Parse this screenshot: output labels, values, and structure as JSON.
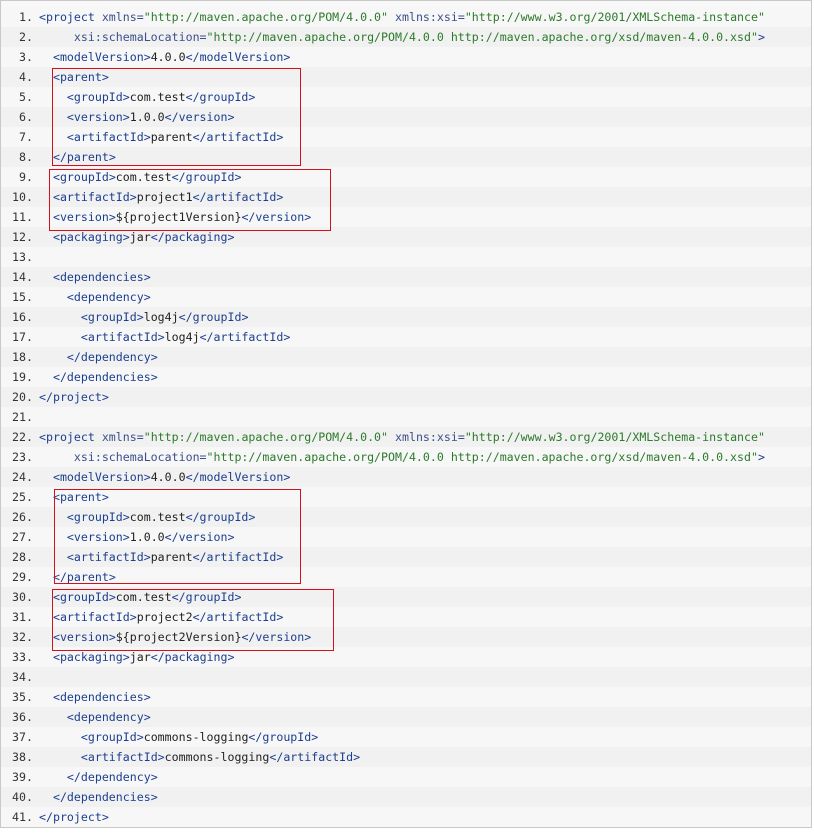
{
  "code_viewer": {
    "highlight_color": "#d3111b",
    "lines": [
      {
        "n": "1.",
        "text": "<project xmlns=\"http://maven.apache.org/POM/4.0.0\" xmlns:xsi=\"http://www.w3.org/2001/XMLSchema-instance\""
      },
      {
        "n": "2.",
        "text": "     xsi:schemaLocation=\"http://maven.apache.org/POM/4.0.0 http://maven.apache.org/xsd/maven-4.0.0.xsd\">"
      },
      {
        "n": "3.",
        "text": "  <modelVersion>4.0.0</modelVersion>"
      },
      {
        "n": "4.",
        "text": "  <parent>"
      },
      {
        "n": "5.",
        "text": "    <groupId>com.test</groupId>"
      },
      {
        "n": "6.",
        "text": "    <version>1.0.0</version>"
      },
      {
        "n": "7.",
        "text": "    <artifactId>parent</artifactId>"
      },
      {
        "n": "8.",
        "text": "  </parent>"
      },
      {
        "n": "9.",
        "text": "  <groupId>com.test</groupId>"
      },
      {
        "n": "10.",
        "text": "  <artifactId>project1</artifactId>"
      },
      {
        "n": "11.",
        "text": "  <version>${project1Version}</version>"
      },
      {
        "n": "12.",
        "text": "  <packaging>jar</packaging>"
      },
      {
        "n": "13.",
        "text": ""
      },
      {
        "n": "14.",
        "text": "  <dependencies>"
      },
      {
        "n": "15.",
        "text": "    <dependency>"
      },
      {
        "n": "16.",
        "text": "      <groupId>log4j</groupId>"
      },
      {
        "n": "17.",
        "text": "      <artifactId>log4j</artifactId>"
      },
      {
        "n": "18.",
        "text": "    </dependency>"
      },
      {
        "n": "19.",
        "text": "  </dependencies>"
      },
      {
        "n": "20.",
        "text": "</project>"
      },
      {
        "n": "21.",
        "text": ""
      },
      {
        "n": "22.",
        "text": "<project xmlns=\"http://maven.apache.org/POM/4.0.0\" xmlns:xsi=\"http://www.w3.org/2001/XMLSchema-instance\""
      },
      {
        "n": "23.",
        "text": "     xsi:schemaLocation=\"http://maven.apache.org/POM/4.0.0 http://maven.apache.org/xsd/maven-4.0.0.xsd\">"
      },
      {
        "n": "24.",
        "text": "  <modelVersion>4.0.0</modelVersion>"
      },
      {
        "n": "25.",
        "text": "  <parent>"
      },
      {
        "n": "26.",
        "text": "    <groupId>com.test</groupId>"
      },
      {
        "n": "27.",
        "text": "    <version>1.0.0</version>"
      },
      {
        "n": "28.",
        "text": "    <artifactId>parent</artifactId>"
      },
      {
        "n": "29.",
        "text": "  </parent>"
      },
      {
        "n": "30.",
        "text": "  <groupId>com.test</groupId>"
      },
      {
        "n": "31.",
        "text": "  <artifactId>project2</artifactId>"
      },
      {
        "n": "32.",
        "text": "  <version>${project2Version}</version>"
      },
      {
        "n": "33.",
        "text": "  <packaging>jar</packaging>"
      },
      {
        "n": "34.",
        "text": ""
      },
      {
        "n": "35.",
        "text": "  <dependencies>"
      },
      {
        "n": "36.",
        "text": "    <dependency>"
      },
      {
        "n": "37.",
        "text": "      <groupId>commons-logging</groupId>"
      },
      {
        "n": "38.",
        "text": "      <artifactId>commons-logging</artifactId>"
      },
      {
        "n": "39.",
        "text": "    </dependency>"
      },
      {
        "n": "40.",
        "text": "  </dependencies>"
      },
      {
        "n": "41.",
        "text": "</project>"
      }
    ]
  }
}
